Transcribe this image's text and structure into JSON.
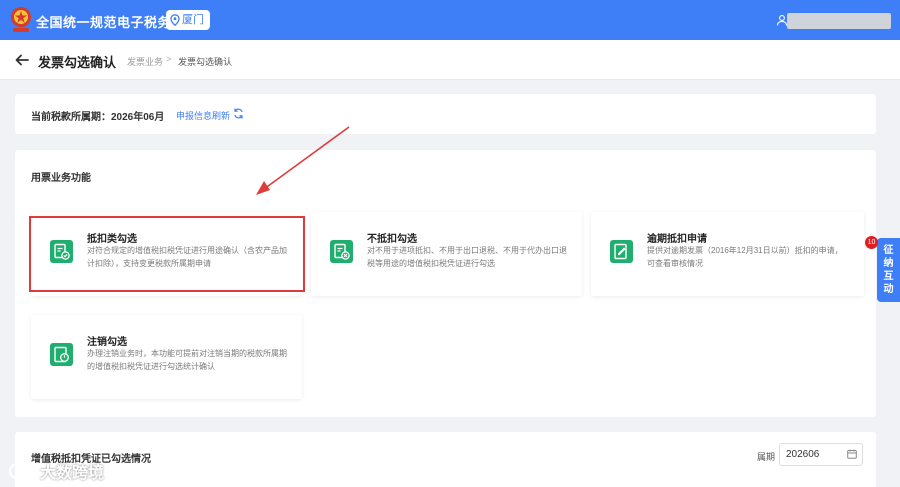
{
  "header": {
    "site_title": "全国统一规范电子税务局",
    "city": "厦门",
    "brand_color": "#3e7ef6"
  },
  "page": {
    "title": "发票勾选确认",
    "breadcrumb": [
      "发票业务",
      "发票勾选确认"
    ],
    "breadcrumb_separator": ">"
  },
  "period_card": {
    "label": "当前税款所属期：2026年06月",
    "refresh_link": "申报信息刷新"
  },
  "functions": {
    "section_title": "用票业务功能",
    "items": [
      {
        "title": "抵扣类勾选",
        "desc": "对符合规定的增值税扣税凭证进行用途确认（含农产品加计扣除），支持变更税款所属期申请",
        "icon": "invoice-check-icon",
        "highlighted": true
      },
      {
        "title": "不抵扣勾选",
        "desc": "对不用于进项抵扣、不用于出口退税、不用于代办出口退税等用途的增值税扣税凭证进行勾选",
        "icon": "invoice-cancel-icon",
        "highlighted": false
      },
      {
        "title": "逾期抵扣申请",
        "desc": "提供对逾期发票（2016年12月31日以前）抵扣的申请，可查看审核情况",
        "icon": "document-edit-icon",
        "highlighted": false
      },
      {
        "title": "注销勾选",
        "desc": "办理注销业务时，本功能可提前对注销当期的税款所属期的增值税扣税凭证进行勾选统计确认",
        "icon": "power-document-icon",
        "highlighted": false
      }
    ]
  },
  "side_tab": {
    "label_lines": [
      "征",
      "纳",
      "互",
      "动"
    ],
    "badge": "10"
  },
  "deduction_status": {
    "title": "增值税抵扣凭证已勾选情况",
    "period_label": "属期",
    "period_value": "202606"
  },
  "watermark": {
    "text": "大数跨境"
  },
  "colors": {
    "accent": "#3e7ef6",
    "icon_green": "#1fae6e",
    "annotation_red": "#e03a3a"
  }
}
